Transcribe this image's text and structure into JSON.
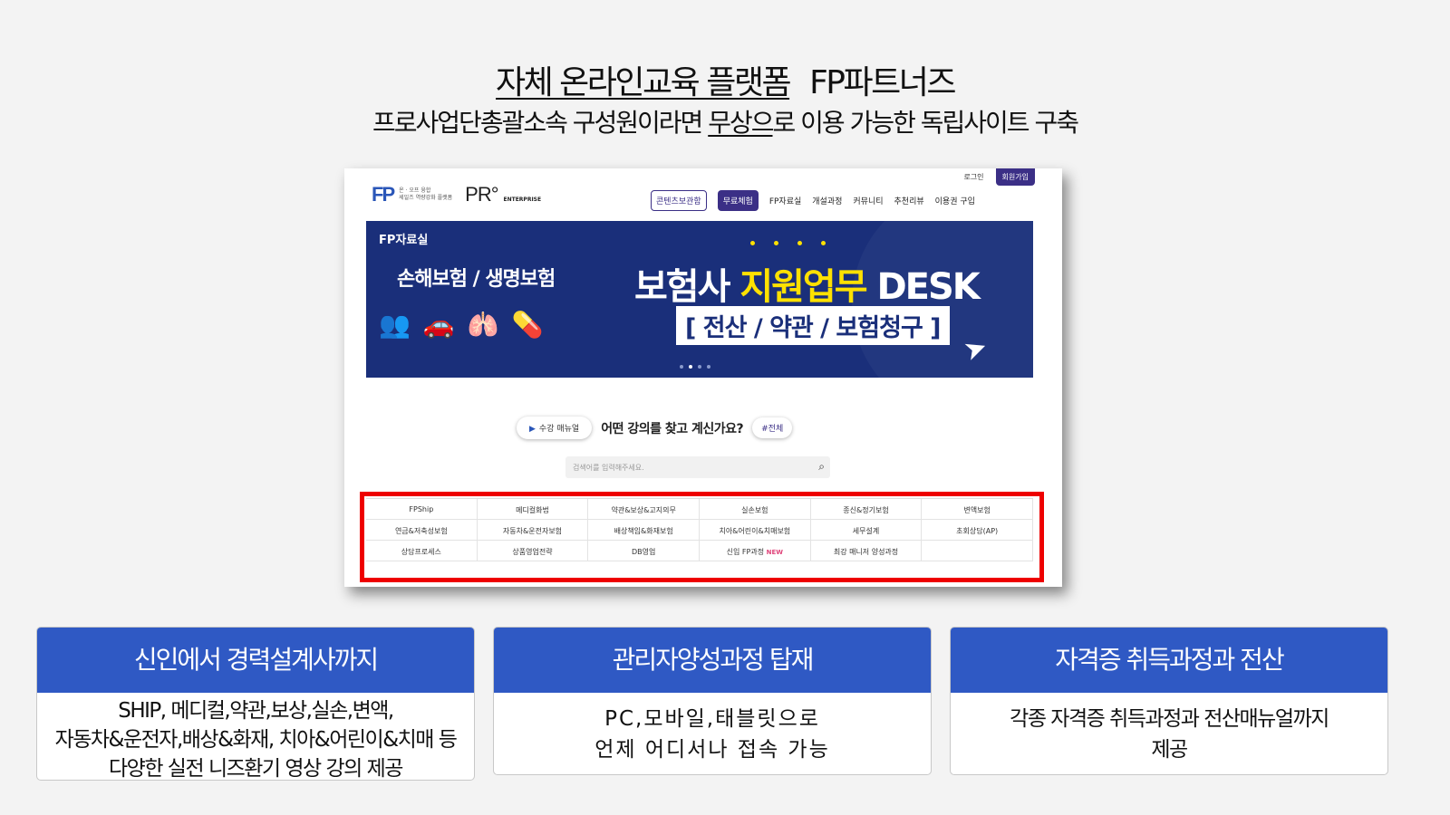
{
  "headline": {
    "part1": "자체 온라인교육 플랫폼",
    "part2": "FP파트너즈"
  },
  "subline": {
    "before": "프로사업단총괄소속 구성원이라면 ",
    "underlined": "무상으",
    "after": "로 이용 가능한 독립사이트 구축"
  },
  "site": {
    "auth": {
      "login": "로그인",
      "join": "회원가입"
    },
    "logo": {
      "fp": "FP",
      "small_line1": "온 · 오프 융합",
      "small_line2": "세일즈 역량강화 플랫폼",
      "pr": "PR°",
      "enterprise": "ENTERPRISE"
    },
    "nav": [
      "콘텐츠보관함",
      "무료체험",
      "FP자료실",
      "개설과정",
      "커뮤니티",
      "추천리뷰",
      "이용권 구입"
    ],
    "banner": {
      "tag": "FP자료실",
      "left": "손해보험 / 생명보험",
      "big_white": "보험사 ",
      "big_yellow": "지원업무",
      "big_white2": " DESK",
      "sub": "[ 전산 / 약관 / 보험청구 ]",
      "icons": [
        "people-icon",
        "car-crash-icon",
        "lungs-icon",
        "medicine-icon"
      ]
    },
    "manual_button": "수강 매뉴얼",
    "question": "어떤 강의를 찾고 계신가요?",
    "tag_all": "#전체",
    "search_placeholder": "검색어를 입력해주세요.",
    "categories": [
      "FPShip",
      "메디컬화법",
      "약관&보상&고지의무",
      "실손보험",
      "종신&정기보험",
      "변액보험",
      "연금&저축성보험",
      "자동차&운전자보험",
      "배상책임&화재보험",
      "치아&어린이&치매보험",
      "세무설계",
      "초회상담(AP)",
      "상담프로세스",
      "상품영업전략",
      "DB영업",
      "신입 FP과정",
      "최강 매니저 양성과정",
      ""
    ],
    "new_badge": "NEW"
  },
  "cards": [
    {
      "title": "신인에서 경력설계사까지",
      "lines": [
        "SHIP, 메디컬,약관,보상,실손,변액,",
        "자동차&운전자,배상&화재, 치아&어린이&치매 등",
        "다양한 실전 니즈환기 영상 강의 제공"
      ]
    },
    {
      "title": "관리자양성과정 탑재",
      "lines": [
        "PC,모바일,태블릿으로",
        "언제 어디서나 접속 가능"
      ]
    },
    {
      "title": "자격증 취득과정과 전산",
      "lines": [
        "각종 자격증 취득과정과 전산매뉴얼까지",
        "제공"
      ]
    }
  ],
  "colors": {
    "card_header": "#2f59c4",
    "banner": "#1a2f7a",
    "highlight_box": "#ee0000",
    "accent": "#3b2f86"
  }
}
